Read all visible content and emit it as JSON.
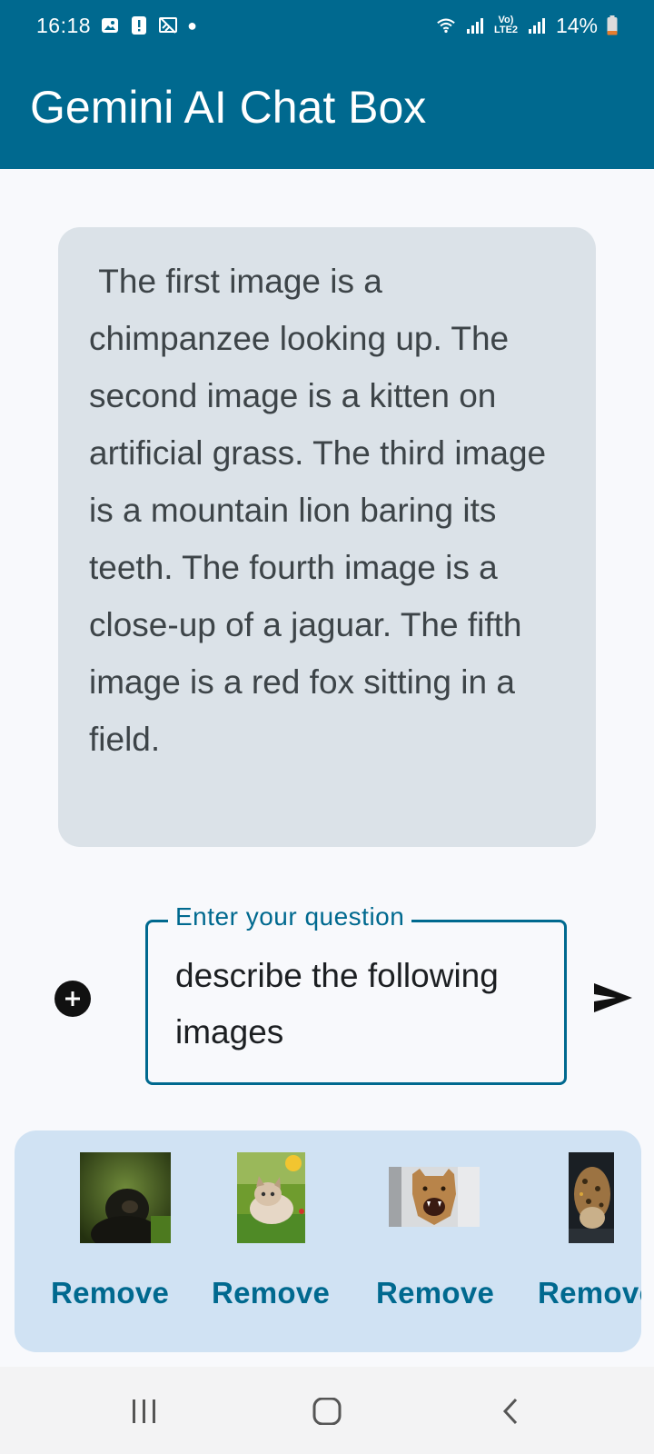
{
  "status_bar": {
    "time": "16:18",
    "battery_percent": "14%",
    "network_label": "Vo) LTE2",
    "icons": [
      "gallery-icon",
      "alert-icon",
      "cast-off-icon",
      "notification-dot",
      "wifi-icon",
      "signal-icon",
      "battery-icon"
    ]
  },
  "app_bar": {
    "title": "Gemini AI Chat Box"
  },
  "chat": {
    "response": " The first image is a chimpanzee looking up. The second image is a kitten on artificial grass. The third image is a mountain lion baring its teeth. The fourth image is a close-up of a jaguar. The fifth image is a red fox sitting in a field."
  },
  "input": {
    "label": "Enter your question",
    "value": "describe the following images"
  },
  "images": [
    {
      "subject": "chimpanzee",
      "remove_label": "Remove"
    },
    {
      "subject": "kitten",
      "remove_label": "Remove"
    },
    {
      "subject": "mountain lion",
      "remove_label": "Remove"
    },
    {
      "subject": "jaguar",
      "remove_label": "Remove"
    }
  ],
  "colors": {
    "primary": "#00698f",
    "bubble": "#dbe2e8",
    "strip": "#d0e2f3"
  },
  "nav": {
    "icons": [
      "recent-apps-icon",
      "home-icon",
      "back-icon"
    ]
  }
}
